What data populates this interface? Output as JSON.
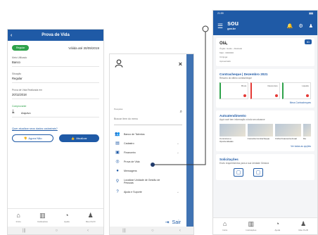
{
  "screen1": {
    "title": "Prova de Vida",
    "back_icon": "back-arrow-icon",
    "status_badge": "Regular",
    "valid_until": "Válida até 30/09/2019",
    "fields": [
      {
        "label": "Meio Utilizado",
        "value": "Banco"
      },
      {
        "label": "Situação",
        "value": "Regular"
      },
      {
        "label": "Prova de Vida Realizada em",
        "value": "20/11/2018"
      },
      {
        "label": "Comprovante",
        "value": "Arquivo"
      }
    ],
    "feedback_question": "Quer atualizar seus dados cadastrais?",
    "btn_no": "Agora Não",
    "btn_yes": "Atualizar"
  },
  "bottom_nav": [
    {
      "label": "Início",
      "icon": "home-icon"
    },
    {
      "label": "Instituições",
      "icon": "building-icon"
    },
    {
      "label": "Ajuda",
      "icon": "chat-icon"
    },
    {
      "label": "Meu Perfil",
      "icon": "user-icon"
    }
  ],
  "screen2": {
    "close": "×",
    "search_label": "Pesquisa",
    "search_placeholder": "Buscar item do menu",
    "menu": [
      {
        "label": "Banco de Talentos",
        "icon": "people-icon"
      },
      {
        "label": "Cadastro",
        "icon": "document-icon"
      },
      {
        "label": "Financeiro",
        "icon": "money-icon"
      },
      {
        "label": "Prova de Vida",
        "icon": "fingerprint-icon"
      },
      {
        "label": "Mensagens",
        "icon": "message-icon"
      },
      {
        "label": "Localizar Unidade de Gestão de Pessoas",
        "icon": "location-icon"
      },
      {
        "label": "Ajuda e Suporte",
        "icon": "help-icon"
      }
    ],
    "logout": "Sair"
  },
  "screen3": {
    "status_time": "21:59",
    "logo_top": "sou",
    "logo_bottom": "gov.br",
    "greeting": "Olá,",
    "id_tag": "ID",
    "info_lines": [
      "Órgão: Goiás - Afastado",
      "Matr.: 0000000",
      "Cônjuge:",
      "Aposentado"
    ],
    "contracheque_title": "Contracheque | Dezembro 2021",
    "contracheque_sub": "Resumo do último contracheque",
    "tiles": [
      "Bruto",
      "Descontos",
      "Líquido"
    ],
    "contracheque_link": "Meus Contracheques",
    "autoatendimento_title": "Autoatendimento",
    "autoatendimento_sub": "Aqui você tem informação a todo seu alcance",
    "services": [
      "Concursos e Oportunidades",
      "Consulta Contracheque",
      "Ficha Financeira Anual",
      "Da"
    ],
    "services_link": "Ver todas as opções",
    "solicitacoes_title": "Solicitações",
    "solicitacoes_sub": "Envio requerimentos para a sua Unidade Gestora"
  }
}
